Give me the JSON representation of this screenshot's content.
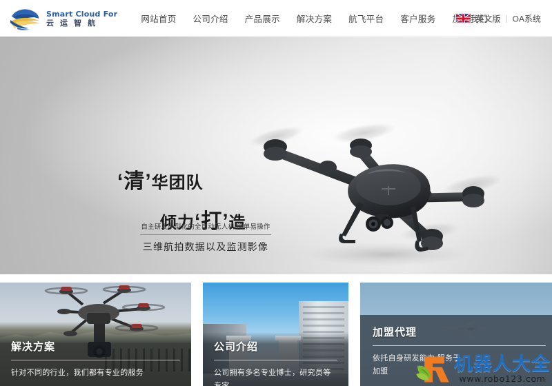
{
  "header": {
    "logo": {
      "icon": "cloud-swoosh-logo",
      "english": "Smart Cloud For",
      "chinese": "云 运 智 航"
    },
    "nav": [
      {
        "label": "网站首页"
      },
      {
        "label": "公司介绍"
      },
      {
        "label": "产品展示"
      },
      {
        "label": "解决方案"
      },
      {
        "label": "航飞平台"
      },
      {
        "label": "客户服务"
      },
      {
        "label": "加入我们"
      }
    ],
    "right": {
      "flag_icon": "uk-flag-icon",
      "lang_label": "英文版",
      "separator": "|",
      "oa_label": "OA系统"
    }
  },
  "hero": {
    "headline_line1_pre": "‘清’",
    "headline_line1_post": "华团队",
    "headline_line2_pre": "倾力",
    "headline_line2_mid": "‘打’",
    "headline_line2_post": "造",
    "sub_small": "自主研发小型化的全自动无人机 简单易操作",
    "sub_large": "三维航拍数据以及监测影像",
    "image_alt": "black-quadcopter-drone"
  },
  "cards": [
    {
      "title": "解决方案",
      "desc": "针对不同的行业，我们都有专业的服务",
      "image_alt": "hexacopter-drone-over-hills"
    },
    {
      "title": "公司介绍",
      "desc": "公司拥有多名专业博士，研究员等专家",
      "image_alt": "campus-buildings"
    },
    {
      "title": "加盟代理",
      "desc_line1": "依托自身研发能力,服务于",
      "desc_line2": "加盟",
      "image_alt": "fixed-wing-uav-in-sky"
    }
  ],
  "watermark": {
    "logo_icon": "robo123-leaf-r-logo",
    "site_name": "机器人大全",
    "url": "www.robo123.com"
  },
  "colors": {
    "logo_blue": "#2a5fa8",
    "logo_gold": "#f0b93c",
    "nav_text": "#4b4b4b",
    "card3_overlay": "#424e5a",
    "watermark_blue": "#1f6ec0",
    "watermark_orange": "#ef7c22",
    "watermark_green": "#7cb82f"
  }
}
